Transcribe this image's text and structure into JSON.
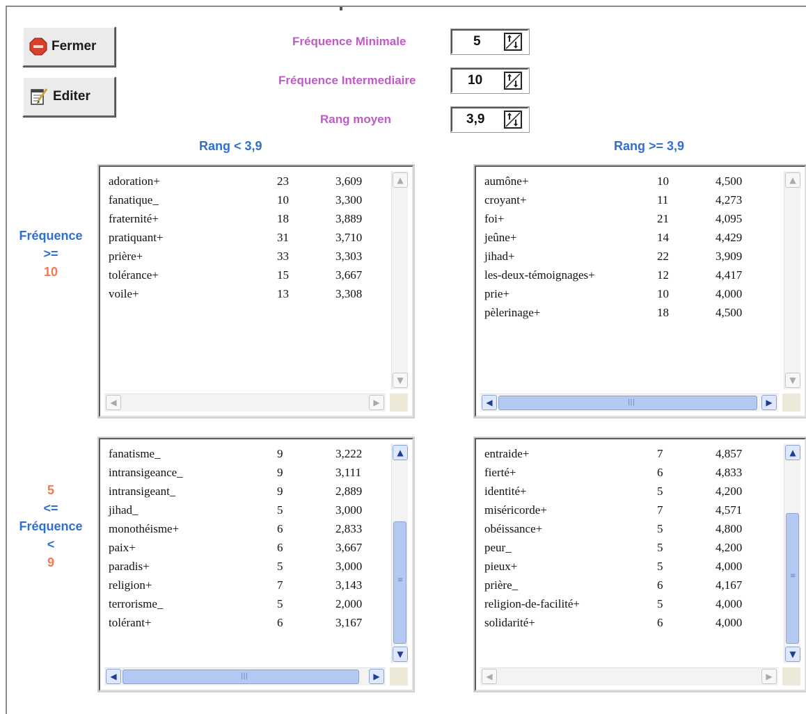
{
  "buttons": {
    "close_label": "Fermer",
    "edit_label": "Editer"
  },
  "params": {
    "min_freq": {
      "label": "Fréquence Minimale",
      "value": "5"
    },
    "inter_freq": {
      "label": "Fréquence Intermediaire",
      "value": "10"
    },
    "mean_rank": {
      "label": "Rang moyen",
      "value": "3,9"
    }
  },
  "columns": {
    "left": "Rang < 3,9",
    "right": "Rang >= 3,9"
  },
  "row_labels": {
    "top": [
      "Fréquence",
      ">=",
      "10"
    ],
    "bottom": [
      "5",
      "<=",
      "Fréquence",
      "<",
      "9"
    ]
  },
  "quadrants": {
    "top_left": [
      [
        "adoration+",
        "23",
        "3,609"
      ],
      [
        "fanatique_",
        "10",
        "3,300"
      ],
      [
        "fraternité+",
        "18",
        "3,889"
      ],
      [
        "pratiquant+",
        "31",
        "3,710"
      ],
      [
        "prière+",
        "33",
        "3,303"
      ],
      [
        "tolérance+",
        "15",
        "3,667"
      ],
      [
        "voile+",
        "13",
        "3,308"
      ]
    ],
    "top_right": [
      [
        "aumône+",
        "10",
        "4,500"
      ],
      [
        "croyant+",
        "11",
        "4,273"
      ],
      [
        "foi+",
        "21",
        "4,095"
      ],
      [
        "jeûne+",
        "14",
        "4,429"
      ],
      [
        "jihad+",
        "22",
        "3,909"
      ],
      [
        "les-deux-témoignages+",
        "12",
        "4,417"
      ],
      [
        "prie+",
        "10",
        "4,000"
      ],
      [
        "pèlerinage+",
        "18",
        "4,500"
      ]
    ],
    "bottom_left": [
      [
        "fanatisme_",
        "9",
        "3,222"
      ],
      [
        "intransigeance_",
        "9",
        "3,111"
      ],
      [
        "intransigeant_",
        "9",
        "2,889"
      ],
      [
        "jihad_",
        "5",
        "3,000"
      ],
      [
        "monothéisme+",
        "6",
        "2,833"
      ],
      [
        "paix+",
        "6",
        "3,667"
      ],
      [
        "paradis+",
        "5",
        "3,000"
      ],
      [
        "religion+",
        "7",
        "3,143"
      ],
      [
        "terrorisme_",
        "5",
        "2,000"
      ],
      [
        "tolérant+",
        "6",
        "3,167"
      ]
    ],
    "bottom_right": [
      [
        "entraide+",
        "7",
        "4,857"
      ],
      [
        "fierté+",
        "6",
        "4,833"
      ],
      [
        "identité+",
        "5",
        "4,200"
      ],
      [
        "miséricorde+",
        "7",
        "4,571"
      ],
      [
        "obéissance+",
        "5",
        "4,800"
      ],
      [
        "peur_",
        "5",
        "4,200"
      ],
      [
        "pieux+",
        "5",
        "4,000"
      ],
      [
        "prière_",
        "6",
        "4,167"
      ],
      [
        "religion-de-facilité+",
        "5",
        "4,000"
      ],
      [
        "solidarité+",
        "6",
        "4,000"
      ]
    ]
  },
  "icons": {
    "close": "stop-sign-icon",
    "edit": "notepad-pencil-icon",
    "spinner": "up-down-arrows-icon"
  },
  "colors": {
    "param_label": "#c05ac8",
    "column_title": "#2f6fd0",
    "number_accent": "#f27a52",
    "scroll_thumb": "#b4c9f2"
  }
}
